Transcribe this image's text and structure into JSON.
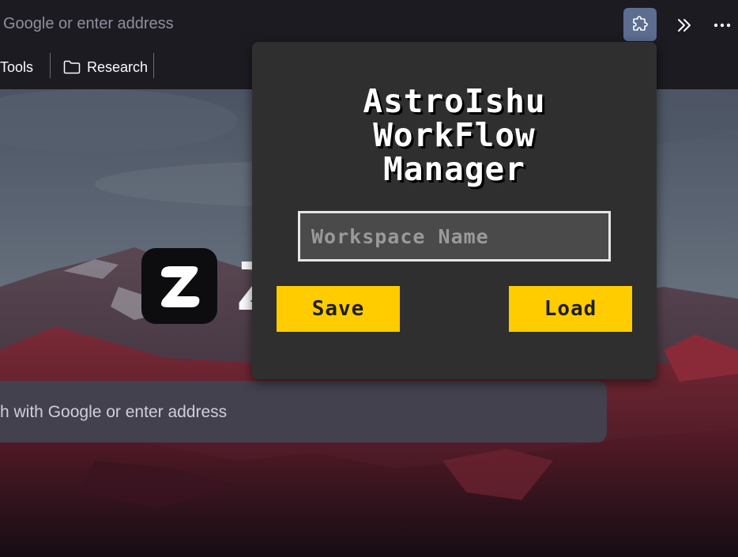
{
  "browser": {
    "address_placeholder": "Google or enter address",
    "bookmarks": [
      {
        "label": "Tools"
      },
      {
        "label": "Research"
      }
    ],
    "icons": {
      "extension": "puzzle-piece-icon",
      "overflow": "double-chevron-right-icon",
      "menu": "ellipsis-icon",
      "folder": "folder-icon"
    },
    "colors": {
      "toolbar": "#1c1b22",
      "extension_button_active": "#5d6d8f"
    }
  },
  "newtab": {
    "brand_letter": "Z",
    "search_placeholder": "h with Google or enter address"
  },
  "popup": {
    "title_lines": [
      "AstroIshu",
      "WorkFlow",
      "Manager"
    ],
    "workspace_placeholder": "Workspace Name",
    "save_label": "Save",
    "load_label": "Load",
    "colors": {
      "background": "#2f2f2f",
      "button": "#ffcc00",
      "input_background": "#4a4a4a"
    }
  }
}
